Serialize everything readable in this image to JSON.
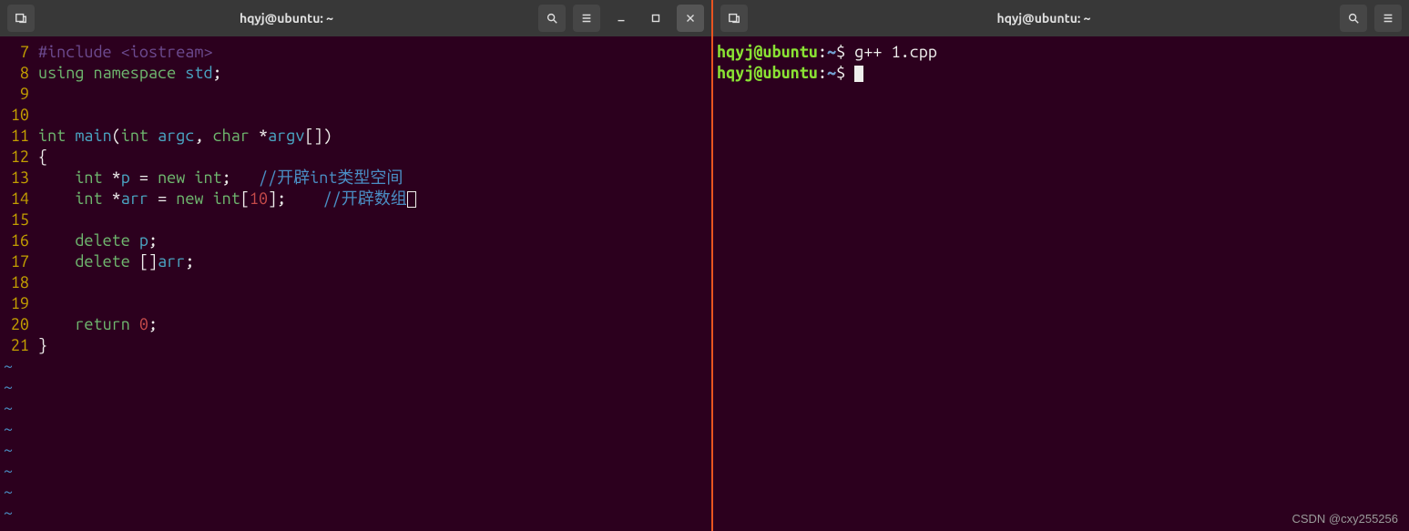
{
  "left": {
    "title": "hqyj@ubuntu: ~",
    "code": {
      "lines": [
        {
          "n": "7",
          "tokens": [
            [
              "pp",
              "#include "
            ],
            [
              "pp",
              "<iostream>"
            ]
          ]
        },
        {
          "n": "8",
          "tokens": [
            [
              "kw",
              "using "
            ],
            [
              "kw",
              "namespace "
            ],
            [
              "nm",
              "std"
            ],
            [
              "pn",
              ";"
            ]
          ]
        },
        {
          "n": "9",
          "tokens": []
        },
        {
          "n": "10",
          "tokens": []
        },
        {
          "n": "11",
          "tokens": [
            [
              "ty",
              "int "
            ],
            [
              "nm",
              "main"
            ],
            [
              "pn",
              "("
            ],
            [
              "ty",
              "int "
            ],
            [
              "nm",
              "argc"
            ],
            [
              "pn",
              ", "
            ],
            [
              "ty",
              "char "
            ],
            [
              "pn",
              "*"
            ],
            [
              "nm",
              "argv"
            ],
            [
              "pn",
              "[])"
            ]
          ]
        },
        {
          "n": "12",
          "tokens": [
            [
              "pn",
              "{"
            ]
          ]
        },
        {
          "n": "13",
          "tokens": [
            [
              "pn",
              "    "
            ],
            [
              "ty",
              "int "
            ],
            [
              "pn",
              "*"
            ],
            [
              "nm",
              "p"
            ],
            [
              "pn",
              " = "
            ],
            [
              "kw",
              "new "
            ],
            [
              "ty",
              "int"
            ],
            [
              "pn",
              ";   "
            ],
            [
              "cm",
              "//开辟int类型空间"
            ]
          ]
        },
        {
          "n": "14",
          "tokens": [
            [
              "pn",
              "    "
            ],
            [
              "ty",
              "int "
            ],
            [
              "pn",
              "*"
            ],
            [
              "nm",
              "arr"
            ],
            [
              "pn",
              " = "
            ],
            [
              "kw",
              "new "
            ],
            [
              "ty",
              "int"
            ],
            [
              "pn",
              "["
            ],
            [
              "lit",
              "10"
            ],
            [
              "pn",
              "];    "
            ],
            [
              "cm",
              "//开辟数组"
            ],
            [
              "cursorbox",
              ""
            ]
          ]
        },
        {
          "n": "15",
          "tokens": []
        },
        {
          "n": "16",
          "tokens": [
            [
              "pn",
              "    "
            ],
            [
              "kw",
              "delete "
            ],
            [
              "nm",
              "p"
            ],
            [
              "pn",
              ";"
            ]
          ]
        },
        {
          "n": "17",
          "tokens": [
            [
              "pn",
              "    "
            ],
            [
              "kw",
              "delete "
            ],
            [
              "pn",
              "[]"
            ],
            [
              "nm",
              "arr"
            ],
            [
              "pn",
              ";"
            ]
          ]
        },
        {
          "n": "18",
          "tokens": []
        },
        {
          "n": "19",
          "tokens": []
        },
        {
          "n": "20",
          "tokens": [
            [
              "pn",
              "    "
            ],
            [
              "kw",
              "return "
            ],
            [
              "lit",
              "0"
            ],
            [
              "pn",
              ";"
            ]
          ]
        },
        {
          "n": "21",
          "tokens": [
            [
              "pn",
              "}"
            ]
          ]
        }
      ],
      "tilde_rows": 8
    }
  },
  "right": {
    "title": "hqyj@ubuntu: ~",
    "prompt": {
      "user": "hqyj",
      "at": "@",
      "host": "ubuntu",
      "sep1": ":",
      "path": "~",
      "sep2": "$ "
    },
    "commands": [
      {
        "cmd": "g++ 1.cpp"
      },
      {
        "cmd": "",
        "cursor": true
      }
    ]
  },
  "watermark": "CSDN @cxy255256"
}
